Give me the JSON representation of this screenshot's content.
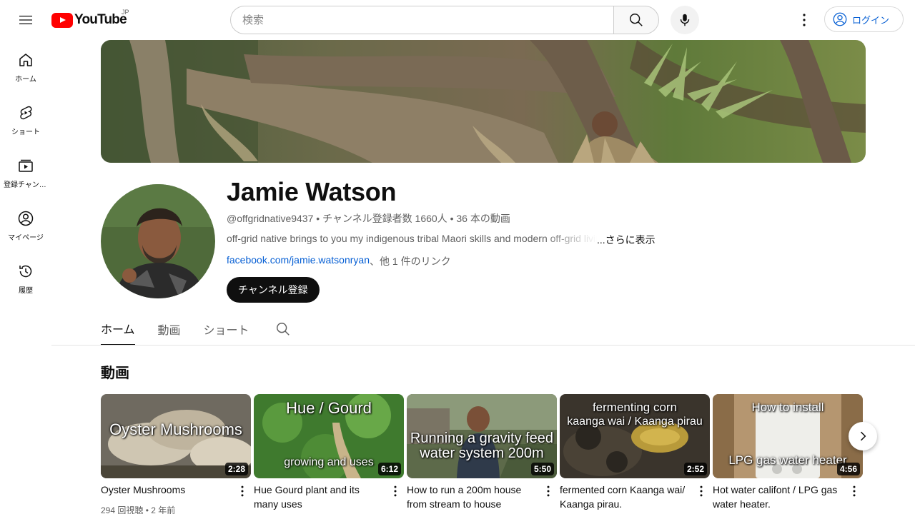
{
  "masthead": {
    "logo_text": "YouTube",
    "country_code": "JP",
    "search_placeholder": "検索",
    "login_label": "ログイン"
  },
  "guide": {
    "items": [
      {
        "label": "ホーム",
        "icon": "home-icon"
      },
      {
        "label": "ショート",
        "icon": "shorts-icon"
      },
      {
        "label": "登録チャンネル",
        "icon": "subscriptions-icon"
      },
      {
        "label": "マイページ",
        "icon": "account-icon"
      },
      {
        "label": "履歴",
        "icon": "history-icon"
      }
    ]
  },
  "channel": {
    "name": "Jamie Watson",
    "handle": "@offgridnative9437",
    "subscribers": "チャンネル登録者数 1660人",
    "video_count": "36 本の動画",
    "description": "off-grid native brings to you my indigenous tribal Maori skills and modern off-grid living",
    "more_label": "...さらに表示",
    "link": "facebook.com/jamie.watsonryan",
    "other_links": "、他 1 件のリンク",
    "subscribe_label": "チャンネル登録"
  },
  "tabs": [
    {
      "label": "ホーム",
      "active": true
    },
    {
      "label": "動画",
      "active": false
    },
    {
      "label": "ショート",
      "active": false
    }
  ],
  "section": {
    "title": "動画"
  },
  "videos": [
    {
      "title": "Oyster Mushrooms",
      "duration": "2:28",
      "views": "294 回視聴",
      "age": "2 年前",
      "thumb_text_top": "",
      "thumb_text_main": "Oyster Mushrooms",
      "thumb_text_bottom": ""
    },
    {
      "title": "Hue Gourd plant and its many uses",
      "duration": "6:12",
      "views": "",
      "age": "",
      "thumb_text_top": "Hue / Gourd",
      "thumb_text_main": "",
      "thumb_text_bottom": "growing and uses"
    },
    {
      "title": "How to run a 200m house from stream to house",
      "duration": "5:50",
      "views": "",
      "age": "",
      "thumb_text_top": "",
      "thumb_text_main": "Running a gravity feed water system 200m",
      "thumb_text_bottom": ""
    },
    {
      "title": "fermented corn Kaanga wai/ Kaanga pirau.",
      "duration": "2:52",
      "views": "",
      "age": "",
      "thumb_text_top": "fermenting corn",
      "thumb_text_main": "kaanga wai / Kaanga pirau",
      "thumb_text_bottom": ""
    },
    {
      "title": "Hot water califont / LPG gas water heater.",
      "duration": "4:56",
      "views": "",
      "age": "",
      "thumb_text_top": "How to install",
      "thumb_text_main": "",
      "thumb_text_bottom": "LPG gas water heater"
    }
  ],
  "colors": {
    "brand_red": "#ff0000",
    "link_blue": "#065fd4",
    "text_primary": "#0f0f0f",
    "text_secondary": "#606060"
  }
}
